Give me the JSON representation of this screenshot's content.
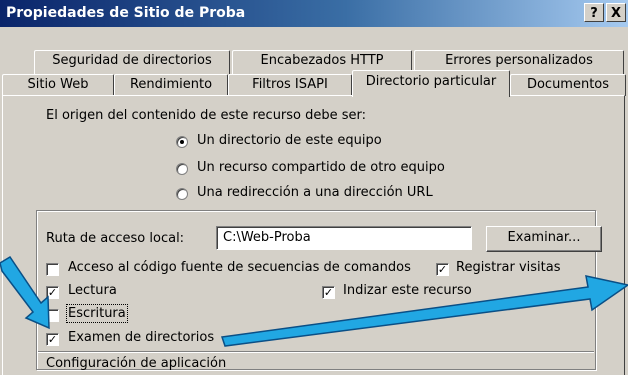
{
  "window": {
    "title": "Propiedades de Sitio de Proba",
    "help_button": "?",
    "close_button": "X"
  },
  "tabs_back": [
    "Seguridad de directorios",
    "Encabezados HTTP",
    "Errores personalizados"
  ],
  "tabs_front": [
    "Sitio Web",
    "Rendimiento",
    "Filtros ISAPI",
    "Directorio particular",
    "Documentos"
  ],
  "active_tab": "Directorio particular",
  "content": {
    "source_label": "El origen del contenido de este recurso debe ser:",
    "radio_options": [
      {
        "label": "Un directorio de este equipo",
        "selected": true
      },
      {
        "label": "Un recurso compartido de otro equipo",
        "selected": false
      },
      {
        "label": "Una redirección a una dirección URL",
        "selected": false
      }
    ],
    "local_path_label": "Ruta de acceso local:",
    "local_path_value": "C:\\Web-Proba",
    "browse_button": "Examinar...",
    "checkboxes": {
      "script_source": {
        "label": "Acceso al código fuente de secuencias de comandos",
        "checked": false
      },
      "log_visits": {
        "label": "Registrar visitas",
        "checked": true
      },
      "read": {
        "label": "Lectura",
        "checked": true
      },
      "index": {
        "label": "Indizar este recurso",
        "checked": true
      },
      "write": {
        "label": "Escritura",
        "checked": false
      },
      "browse": {
        "label": "Examen de directorios",
        "checked": true
      }
    },
    "app_config_label": "Configuración de aplicación"
  },
  "colors": {
    "title_gradient_start": "#0a246a",
    "title_gradient_end": "#a6caf0",
    "face": "#d4d0c8",
    "annotation_arrow": "#21a7e3"
  }
}
